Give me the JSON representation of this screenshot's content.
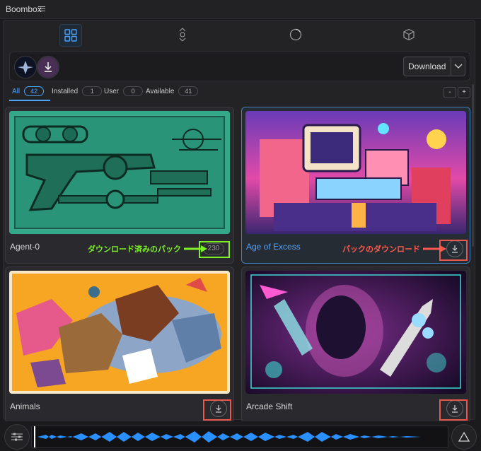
{
  "app": {
    "title": "Boombox"
  },
  "nav": {
    "icons": [
      "grid-icon",
      "mic-search-icon",
      "circle-icon",
      "cube-icon"
    ],
    "active": "grid-icon"
  },
  "toolbar": {
    "download_label": "Download"
  },
  "filters": [
    {
      "label": "All",
      "count": "42",
      "active": true
    },
    {
      "label": "Installed",
      "count": "1"
    },
    {
      "label": "User",
      "count": "0"
    },
    {
      "label": "Available",
      "count": "41"
    }
  ],
  "zoom": {
    "minus": "-",
    "plus": "+"
  },
  "cards": [
    {
      "name": "Agent-0",
      "count": "230",
      "installed": true
    },
    {
      "name": "Age of Excess",
      "selected": true
    },
    {
      "name": "Animals"
    },
    {
      "name": "Arcade Shift"
    }
  ],
  "annotations": {
    "downloaded": "ダウンロード済みのパック",
    "download_pack": "パックのダウンロード"
  },
  "colors": {
    "accent": "#4da3ff",
    "highlight_green": "#7ef02a",
    "highlight_red": "#e8584f"
  }
}
